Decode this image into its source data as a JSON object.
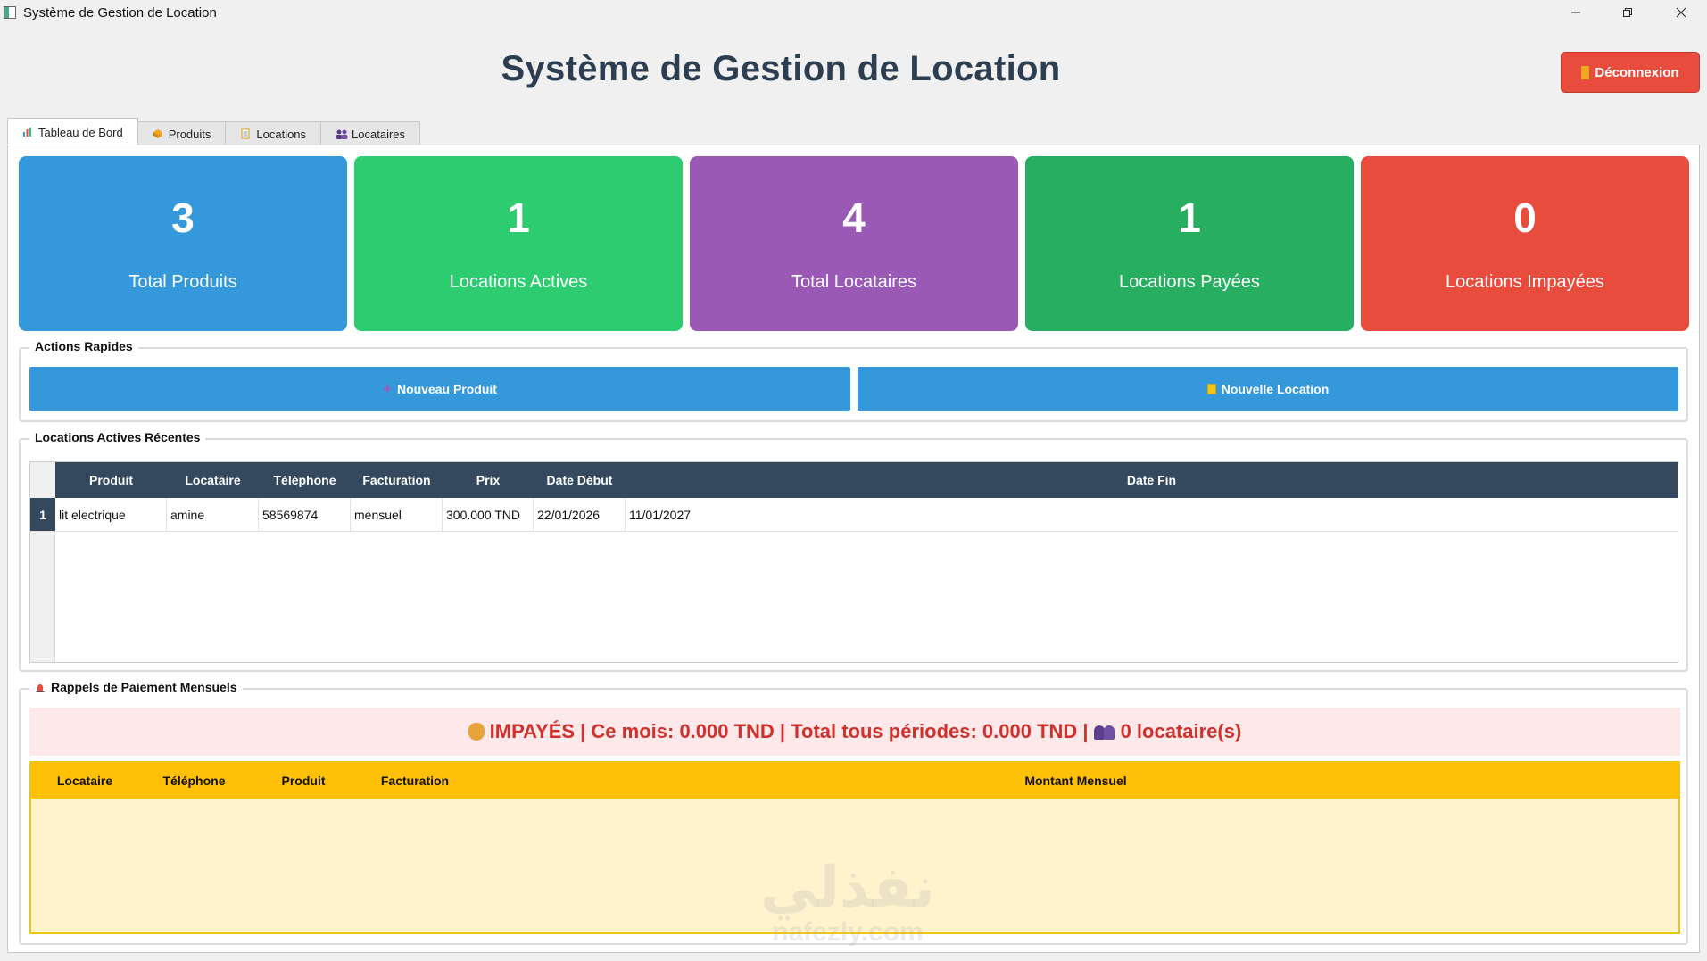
{
  "window": {
    "title": "Système de Gestion de Location"
  },
  "header": {
    "title": "Système de Gestion de Location",
    "logout_label": "Déconnexion"
  },
  "tabs": [
    {
      "label": "Tableau de Bord",
      "icon": "chart-icon",
      "active": true
    },
    {
      "label": "Produits",
      "icon": "box-icon"
    },
    {
      "label": "Locations",
      "icon": "clipboard-icon"
    },
    {
      "label": "Locataires",
      "icon": "people-icon"
    }
  ],
  "stats": [
    {
      "value": "3",
      "label": "Total Produits",
      "color": "#3498db"
    },
    {
      "value": "1",
      "label": "Locations Actives",
      "color": "#2ecc71"
    },
    {
      "value": "4",
      "label": "Total Locataires",
      "color": "#9b59b6"
    },
    {
      "value": "1",
      "label": "Locations Payées",
      "color": "#27ae60"
    },
    {
      "value": "0",
      "label": "Locations Impayées",
      "color": "#e74c3c"
    }
  ],
  "quick_actions": {
    "title": "Actions Rapides",
    "new_product": "Nouveau Produit",
    "new_location": "Nouvelle Location"
  },
  "recent": {
    "title": "Locations Actives Récentes",
    "columns": [
      "Produit",
      "Locataire",
      "Téléphone",
      "Facturation",
      "Prix",
      "Date Début",
      "Date Fin"
    ],
    "rows": [
      {
        "index": "1",
        "cells": [
          "lit electrique",
          "amine",
          "58569874",
          "mensuel",
          "300.000 TND",
          "22/01/2026",
          "11/01/2027"
        ]
      }
    ]
  },
  "reminders": {
    "title": "Rappels de Paiement Mensuels",
    "alert_text": "IMPAYÉS | Ce mois: 0.000 TND | Total tous périodes: 0.000 TND |",
    "alert_count": "0 locataire(s)",
    "columns": [
      "Locataire",
      "Téléphone",
      "Produit",
      "Facturation",
      "Montant Mensuel"
    ]
  },
  "watermark": {
    "arabic": "نفذلي",
    "latin": "nafezly.com"
  },
  "colors": {
    "header_dark": "#34495e",
    "accent_blue": "#3498db",
    "alert_red": "#d0312d",
    "warn_yellow": "#ffc107"
  }
}
